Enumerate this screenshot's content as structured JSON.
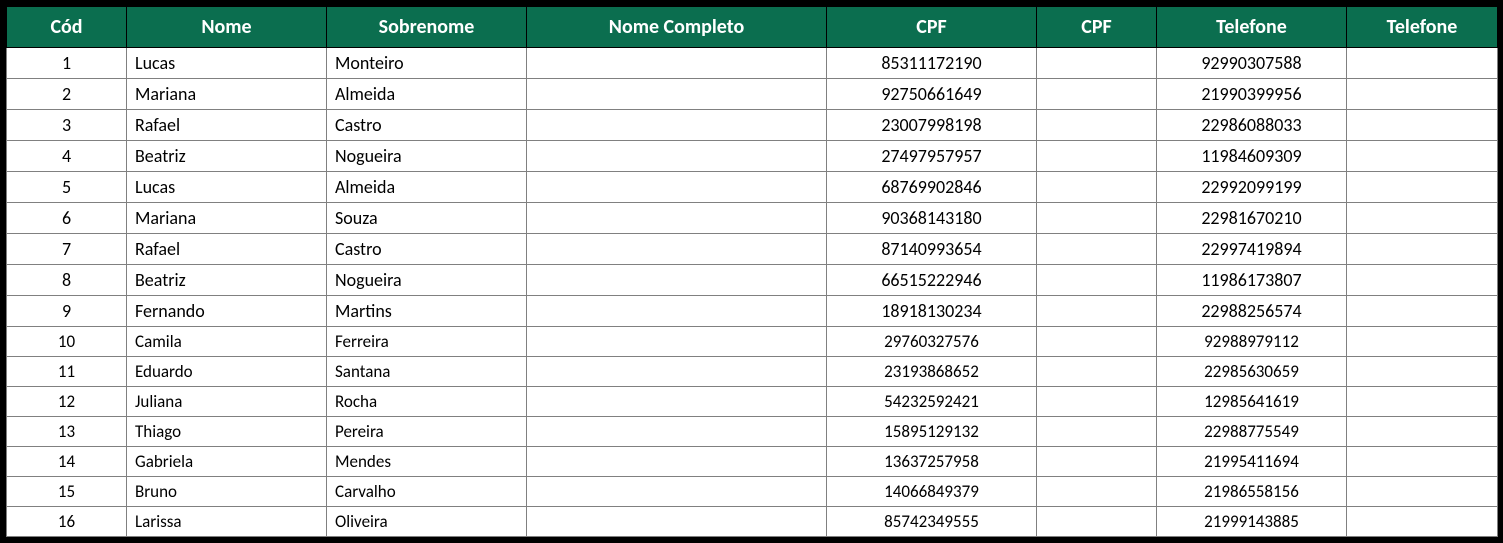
{
  "headers": {
    "cod": "Cód",
    "nome": "Nome",
    "sobrenome": "Sobrenome",
    "nome_completo": "Nome Completo",
    "cpf1": "CPF",
    "cpf2": "CPF",
    "tel1": "Telefone",
    "tel2": "Telefone"
  },
  "rows": [
    {
      "cod": "1",
      "nome": "Lucas",
      "sobrenome": "Monteiro",
      "nome_completo": "",
      "cpf1": "85311172190",
      "cpf2": "",
      "tel1": "92990307588",
      "tel2": ""
    },
    {
      "cod": "2",
      "nome": "Mariana",
      "sobrenome": "Almeida",
      "nome_completo": "",
      "cpf1": "92750661649",
      "cpf2": "",
      "tel1": "21990399956",
      "tel2": ""
    },
    {
      "cod": "3",
      "nome": "Rafael",
      "sobrenome": "Castro",
      "nome_completo": "",
      "cpf1": "23007998198",
      "cpf2": "",
      "tel1": "22986088033",
      "tel2": ""
    },
    {
      "cod": "4",
      "nome": "Beatriz",
      "sobrenome": "Nogueira",
      "nome_completo": "",
      "cpf1": "27497957957",
      "cpf2": "",
      "tel1": "11984609309",
      "tel2": ""
    },
    {
      "cod": "5",
      "nome": "Lucas",
      "sobrenome": "Almeida",
      "nome_completo": "",
      "cpf1": "68769902846",
      "cpf2": "",
      "tel1": "22992099199",
      "tel2": ""
    },
    {
      "cod": "6",
      "nome": "Mariana",
      "sobrenome": "Souza",
      "nome_completo": "",
      "cpf1": "90368143180",
      "cpf2": "",
      "tel1": "22981670210",
      "tel2": ""
    },
    {
      "cod": "7",
      "nome": "Rafael",
      "sobrenome": "Castro",
      "nome_completo": "",
      "cpf1": "87140993654",
      "cpf2": "",
      "tel1": "22997419894",
      "tel2": ""
    },
    {
      "cod": "8",
      "nome": "Beatriz",
      "sobrenome": "Nogueira",
      "nome_completo": "",
      "cpf1": "66515222946",
      "cpf2": "",
      "tel1": "11986173807",
      "tel2": ""
    },
    {
      "cod": "9",
      "nome": "Fernando",
      "sobrenome": "Martins",
      "nome_completo": "",
      "cpf1": "18918130234",
      "cpf2": "",
      "tel1": "22988256574",
      "tel2": ""
    },
    {
      "cod": "10",
      "nome": "Camila",
      "sobrenome": "Ferreira",
      "nome_completo": "",
      "cpf1": "29760327576",
      "cpf2": "",
      "tel1": "92988979112",
      "tel2": ""
    },
    {
      "cod": "11",
      "nome": "Eduardo",
      "sobrenome": "Santana",
      "nome_completo": "",
      "cpf1": "23193868652",
      "cpf2": "",
      "tel1": "22985630659",
      "tel2": ""
    },
    {
      "cod": "12",
      "nome": "Juliana",
      "sobrenome": "Rocha",
      "nome_completo": "",
      "cpf1": "54232592421",
      "cpf2": "",
      "tel1": "12985641619",
      "tel2": ""
    },
    {
      "cod": "13",
      "nome": "Thiago",
      "sobrenome": "Pereira",
      "nome_completo": "",
      "cpf1": "15895129132",
      "cpf2": "",
      "tel1": "22988775549",
      "tel2": ""
    },
    {
      "cod": "14",
      "nome": "Gabriela",
      "sobrenome": "Mendes",
      "nome_completo": "",
      "cpf1": "13637257958",
      "cpf2": "",
      "tel1": "21995411694",
      "tel2": ""
    },
    {
      "cod": "15",
      "nome": "Bruno",
      "sobrenome": "Carvalho",
      "nome_completo": "",
      "cpf1": "14066849379",
      "cpf2": "",
      "tel1": "21986558156",
      "tel2": ""
    },
    {
      "cod": "16",
      "nome": "Larissa",
      "sobrenome": "Oliveira",
      "nome_completo": "",
      "cpf1": "85742349555",
      "cpf2": "",
      "tel1": "21999143885",
      "tel2": ""
    }
  ]
}
